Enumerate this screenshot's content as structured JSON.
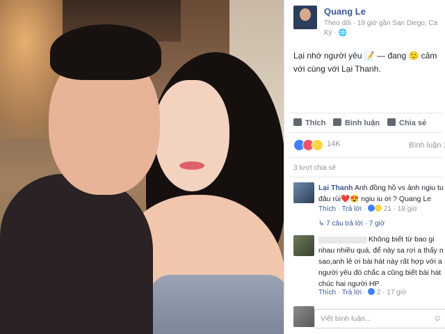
{
  "post": {
    "author": "Quang Le",
    "meta_line1": "Theo dõi · 19 giờ gần San Diego, Ca",
    "meta_line2": "Ký · 🌐",
    "text_line1": "Lại nhớ người yêu 📝 — đang 🙂 cảm",
    "text_line2": "với cùng với Lại Thanh."
  },
  "actions": {
    "like": "Thích",
    "comment": "Bình luận",
    "share": "Chia sẻ"
  },
  "reactions": {
    "count": "14K",
    "comment_count": "Bình luận 1",
    "shares": "3 lượt chia sẻ",
    "colors": {
      "like": "#4080ff",
      "love": "#f25268",
      "haha": "#fcd443"
    }
  },
  "comments": [
    {
      "author": "Lại Thanh",
      "text_line1": "Anh đồng hồ vs ảnh ngiu tu",
      "text_line2": "đâu rùi❤️😍 ngiu iu ơi ? Quang Le",
      "like": "Thích",
      "reply": "Trả lời",
      "reacts": "21",
      "time": "18 giờ",
      "replies": "7 câu trả lời · 7 giờ"
    },
    {
      "author": "",
      "lines": [
        "Không biết từ bao gi",
        "nhau nhiều quá, để này sa rơi a thấy n",
        "sao,anh lê ơi bài hát này rất hợp với a",
        "người yêu đó chắc a cũng biết bài hát",
        "chúc hai người HP"
      ],
      "like": "Thích",
      "reply": "Trả lời",
      "reacts": "2",
      "time": "17 giờ"
    }
  ],
  "input": {
    "placeholder": "Viết bình luận..."
  }
}
